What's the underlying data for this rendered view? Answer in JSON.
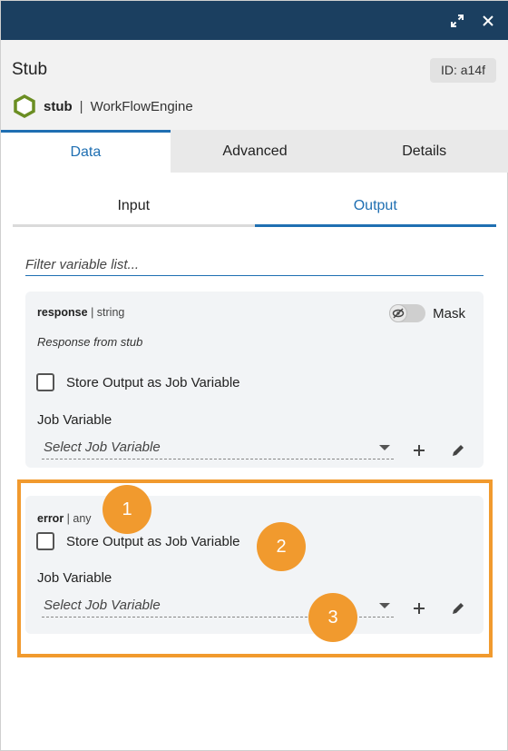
{
  "window": {
    "title": "Stub",
    "id_badge": "ID: a14f"
  },
  "engine": {
    "name": "stub",
    "separator": "|",
    "type": "WorkFlowEngine"
  },
  "tabs": [
    {
      "label": "Data",
      "active": true
    },
    {
      "label": "Advanced",
      "active": false
    },
    {
      "label": "Details",
      "active": false
    }
  ],
  "subtabs": [
    {
      "label": "Input",
      "active": false
    },
    {
      "label": "Output",
      "active": true
    }
  ],
  "filter": {
    "placeholder": "Filter variable list..."
  },
  "variables": [
    {
      "name": "response",
      "type_text": " | string",
      "description": "Response from stub",
      "mask_label": "Mask",
      "store_label": "Store Output as Job Variable",
      "store_checked": false,
      "job_variable_label": "Job Variable",
      "select_placeholder": "Select Job Variable"
    },
    {
      "name": "error",
      "type_text": " | any",
      "store_label": "Store Output as Job Variable",
      "store_checked": false,
      "job_variable_label": "Job Variable",
      "select_placeholder": "Select Job Variable"
    }
  ],
  "annotations": {
    "highlight_color": "#f19a2e",
    "markers": [
      "1",
      "2",
      "3"
    ]
  },
  "colors": {
    "titlebar": "#1b3f60",
    "accent": "#1f6fb2",
    "hex_icon": "#6b8e23"
  },
  "icons": [
    "expand-icon",
    "close-icon",
    "hexagon-icon",
    "eye-off-icon",
    "plus-icon",
    "pencil-icon",
    "chevron-down-icon"
  ]
}
